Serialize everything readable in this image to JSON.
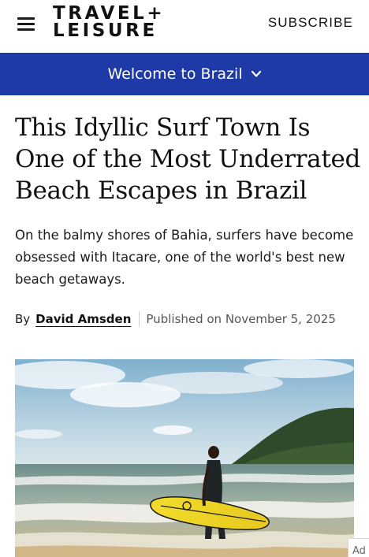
{
  "header": {
    "logo_line1": "TRAVEL+",
    "logo_line2": "LEISURE",
    "subscribe_label": "SUBSCRIBE",
    "menu_icon": "hamburger-menu-icon"
  },
  "nav": {
    "label": "Welcome to Brazil",
    "icon": "chevron-down-icon",
    "color": "#1d3aa6"
  },
  "article": {
    "headline": "This Idyllic Surf Town Is One of the Most Underrated Beach Escapes in Brazil",
    "dek": "On the balmy shores of Bahia, surfers have become obsessed with Itacare, one of the world's best new beach getaways.",
    "by_label": "By",
    "author": "David Amsden",
    "published": "Published on November 5, 2025"
  },
  "ad": {
    "label": "Ad"
  }
}
